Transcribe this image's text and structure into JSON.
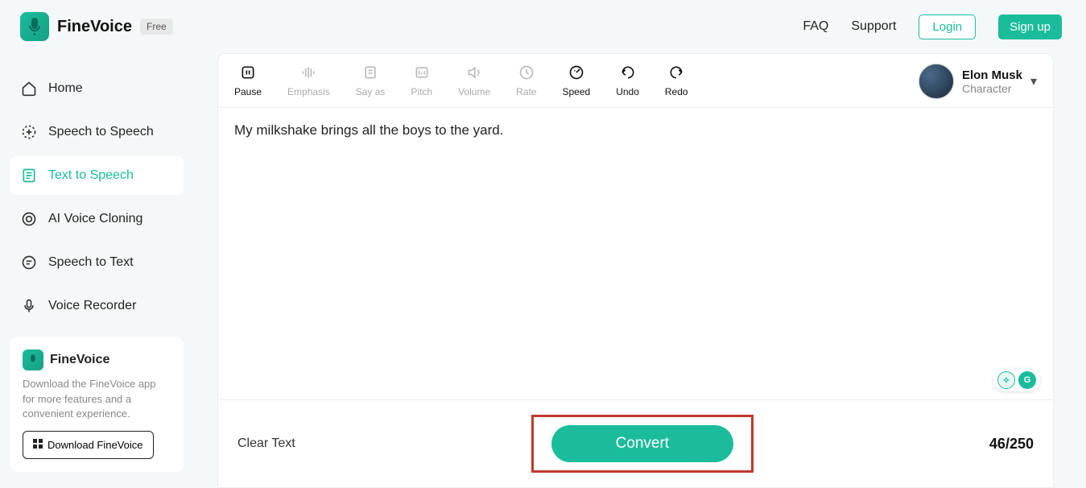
{
  "brand": {
    "name": "FineVoice",
    "badge": "Free"
  },
  "header": {
    "faq": "FAQ",
    "support": "Support",
    "login": "Login",
    "signup": "Sign up"
  },
  "sidebar": {
    "items": [
      {
        "label": "Home"
      },
      {
        "label": "Speech to Speech"
      },
      {
        "label": "Text to Speech"
      },
      {
        "label": "AI Voice Cloning"
      },
      {
        "label": "Speech to Text"
      },
      {
        "label": "Voice Recorder"
      }
    ],
    "active_index": 2
  },
  "promo": {
    "title": "FineVoice",
    "desc": "Download the FineVoice app for more features and a convenient experience.",
    "button": "Download FineVoice"
  },
  "toolbar": {
    "items": [
      {
        "label": "Pause",
        "active": true
      },
      {
        "label": "Emphasis",
        "active": false
      },
      {
        "label": "Say as",
        "active": false
      },
      {
        "label": "Pitch",
        "active": false
      },
      {
        "label": "Volume",
        "active": false
      },
      {
        "label": "Rate",
        "active": false
      },
      {
        "label": "Speed",
        "active": true
      },
      {
        "label": "Undo",
        "active": true
      },
      {
        "label": "Redo",
        "active": true
      }
    ]
  },
  "character": {
    "name": "Elon Musk",
    "sub": "Character"
  },
  "editor": {
    "text": "My milkshake brings all the boys to the yard."
  },
  "float": {
    "b1": "✧",
    "b2": "G"
  },
  "footer": {
    "clear": "Clear Text",
    "convert": "Convert",
    "counter": "46/250"
  }
}
